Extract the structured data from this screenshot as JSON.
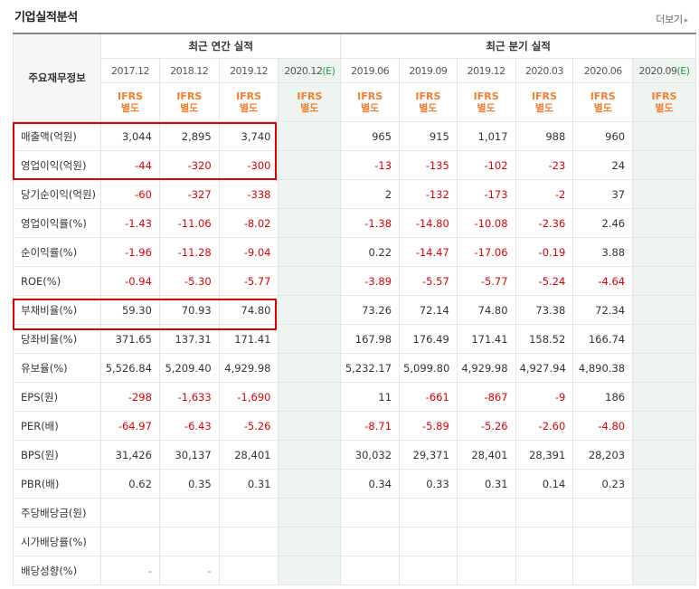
{
  "header": {
    "title": "기업실적분석",
    "more_label": "더보기"
  },
  "table": {
    "corner_label": "주요재무정보",
    "group_annual": "최근 연간 실적",
    "group_quarterly": "최근 분기 실적",
    "periods": [
      {
        "label": "2017.12"
      },
      {
        "label": "2018.12"
      },
      {
        "label": "2019.12"
      },
      {
        "label": "2020.12",
        "est": "(E)"
      },
      {
        "label": "2019.06"
      },
      {
        "label": "2019.09"
      },
      {
        "label": "2019.12"
      },
      {
        "label": "2020.03"
      },
      {
        "label": "2020.06"
      },
      {
        "label": "2020.09",
        "est": "(E)"
      }
    ],
    "standard_line1": "IFRS",
    "standard_line2": "별도",
    "rows": [
      {
        "label": "매출액(억원)",
        "values": [
          "3,044",
          "2,895",
          "3,740",
          "",
          "965",
          "915",
          "1,017",
          "988",
          "960",
          ""
        ]
      },
      {
        "label": "영업이익(억원)",
        "values": [
          "-44",
          "-320",
          "-300",
          "",
          "-13",
          "-135",
          "-102",
          "-23",
          "24",
          ""
        ]
      },
      {
        "label": "당기순이익(억원)",
        "values": [
          "-60",
          "-327",
          "-338",
          "",
          "2",
          "-132",
          "-173",
          "-2",
          "37",
          ""
        ]
      },
      {
        "label": "영업이익률(%)",
        "values": [
          "-1.43",
          "-11.06",
          "-8.02",
          "",
          "-1.38",
          "-14.80",
          "-10.08",
          "-2.36",
          "2.46",
          ""
        ]
      },
      {
        "label": "순이익률(%)",
        "values": [
          "-1.96",
          "-11.28",
          "-9.04",
          "",
          "0.22",
          "-14.47",
          "-17.06",
          "-0.19",
          "3.88",
          ""
        ]
      },
      {
        "label": "ROE(%)",
        "values": [
          "-0.94",
          "-5.30",
          "-5.77",
          "",
          "-3.89",
          "-5.57",
          "-5.77",
          "-5.24",
          "-4.64",
          ""
        ]
      },
      {
        "label": "부채비율(%)",
        "values": [
          "59.30",
          "70.93",
          "74.80",
          "",
          "73.26",
          "72.14",
          "74.80",
          "73.38",
          "72.34",
          ""
        ]
      },
      {
        "label": "당좌비율(%)",
        "values": [
          "371.65",
          "137.31",
          "171.41",
          "",
          "167.98",
          "176.49",
          "171.41",
          "158.52",
          "166.74",
          ""
        ]
      },
      {
        "label": "유보율(%)",
        "values": [
          "5,526.84",
          "5,209.40",
          "4,929.98",
          "",
          "5,232.17",
          "5,099.80",
          "4,929.98",
          "4,927.94",
          "4,890.38",
          ""
        ]
      },
      {
        "label": "EPS(원)",
        "values": [
          "-298",
          "-1,633",
          "-1,690",
          "",
          "11",
          "-661",
          "-867",
          "-9",
          "186",
          ""
        ]
      },
      {
        "label": "PER(배)",
        "values": [
          "-64.97",
          "-6.43",
          "-5.26",
          "",
          "-8.71",
          "-5.89",
          "-5.26",
          "-2.60",
          "-4.80",
          ""
        ]
      },
      {
        "label": "BPS(원)",
        "values": [
          "31,426",
          "30,137",
          "28,401",
          "",
          "30,032",
          "29,371",
          "28,401",
          "28,391",
          "28,203",
          ""
        ]
      },
      {
        "label": "PBR(배)",
        "values": [
          "0.62",
          "0.35",
          "0.31",
          "",
          "0.34",
          "0.33",
          "0.31",
          "0.14",
          "0.23",
          ""
        ]
      },
      {
        "label": "주당배당금(원)",
        "values": [
          "",
          "",
          "",
          "",
          "",
          "",
          "",
          "",
          "",
          ""
        ]
      },
      {
        "label": "시가배당률(%)",
        "values": [
          "",
          "",
          "",
          "",
          "",
          "",
          "",
          "",
          "",
          ""
        ]
      },
      {
        "label": "배당성향(%)",
        "values": [
          "-",
          "-",
          "",
          "",
          "",
          "",
          "",
          "",
          "",
          ""
        ]
      }
    ]
  },
  "colors": {
    "negative": "#e00000",
    "ifrs": "#f08030",
    "estimate_bg": "#eef4ef",
    "highlight_box": "#e00000"
  }
}
